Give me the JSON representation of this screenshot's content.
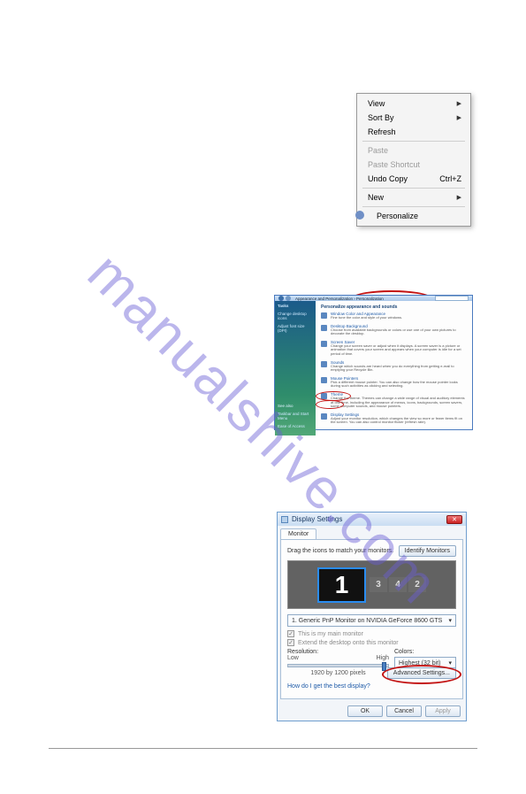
{
  "watermark": "manualshive.com",
  "contextmenu": {
    "items": [
      {
        "label": "View",
        "arrow": true,
        "enabled": true
      },
      {
        "label": "Sort By",
        "arrow": true,
        "enabled": true
      },
      {
        "label": "Refresh",
        "arrow": false,
        "enabled": true
      }
    ],
    "group2": [
      {
        "label": "Paste",
        "arrow": false,
        "enabled": false
      },
      {
        "label": "Paste Shortcut",
        "arrow": false,
        "enabled": false
      },
      {
        "label": "Undo Copy",
        "shortcut": "Ctrl+Z",
        "arrow": false,
        "enabled": true
      }
    ],
    "group3": [
      {
        "label": "New",
        "arrow": true,
        "enabled": true
      }
    ],
    "group4": [
      {
        "label": "Personalize",
        "arrow": false,
        "enabled": true,
        "icon": true
      }
    ]
  },
  "personalization": {
    "breadcrumb": "Appearance and Personalization  ›  Personalization",
    "side": {
      "tasks": "Tasks",
      "link1": "Change desktop icons",
      "link2": "Adjust font size (DPI)",
      "see": "See also",
      "see1": "Taskbar and Start Menu",
      "see2": "Ease of Access"
    },
    "heading": "Personalize appearance and sounds",
    "opts": [
      {
        "t": "Window Color and Appearance",
        "d": "Fine tune the color and style of your windows."
      },
      {
        "t": "Desktop Background",
        "d": "Choose from available backgrounds or colors or use one of your own pictures to decorate the desktop."
      },
      {
        "t": "Screen Saver",
        "d": "Change your screen saver or adjust when it displays. A screen saver is a picture or animation that covers your screen and appears when your computer is idle for a set period of time."
      },
      {
        "t": "Sounds",
        "d": "Change which sounds are heard when you do everything from getting e-mail to emptying your Recycle Bin."
      },
      {
        "t": "Mouse Pointers",
        "d": "Pick a different mouse pointer. You can also change how the mouse pointer looks during such activities as clicking and selecting."
      },
      {
        "t": "Theme",
        "d": "Change the theme. Themes can change a wide range of visual and auditory elements at one time, including the appearance of menus, icons, backgrounds, screen savers, some computer sounds, and mouse pointers."
      },
      {
        "t": "Display Settings",
        "d": "Adjust your monitor resolution, which changes the view so more or fewer items fit on the screen. You can also control monitor flicker (refresh rate)."
      }
    ]
  },
  "display": {
    "title": "Display Settings",
    "tab": "Monitor",
    "drag": "Drag the icons to match your monitors.",
    "identify": "Identify Monitors",
    "monitors": {
      "main": "1",
      "others": [
        "3",
        "4",
        "2"
      ]
    },
    "selector": "1. Generic PnP Monitor on NVIDIA GeForce 8600 GTS",
    "chk1": "This is my main monitor",
    "chk2": "Extend the desktop onto this monitor",
    "resolution_label": "Resolution:",
    "low": "Low",
    "high": "High",
    "current": "1920 by 1200 pixels",
    "colors_label": "Colors:",
    "colors_value": "Highest (32 bit)",
    "help": "How do I get the best display?",
    "advanced": "Advanced Settings...",
    "ok": "OK",
    "cancel": "Cancel",
    "apply": "Apply"
  }
}
